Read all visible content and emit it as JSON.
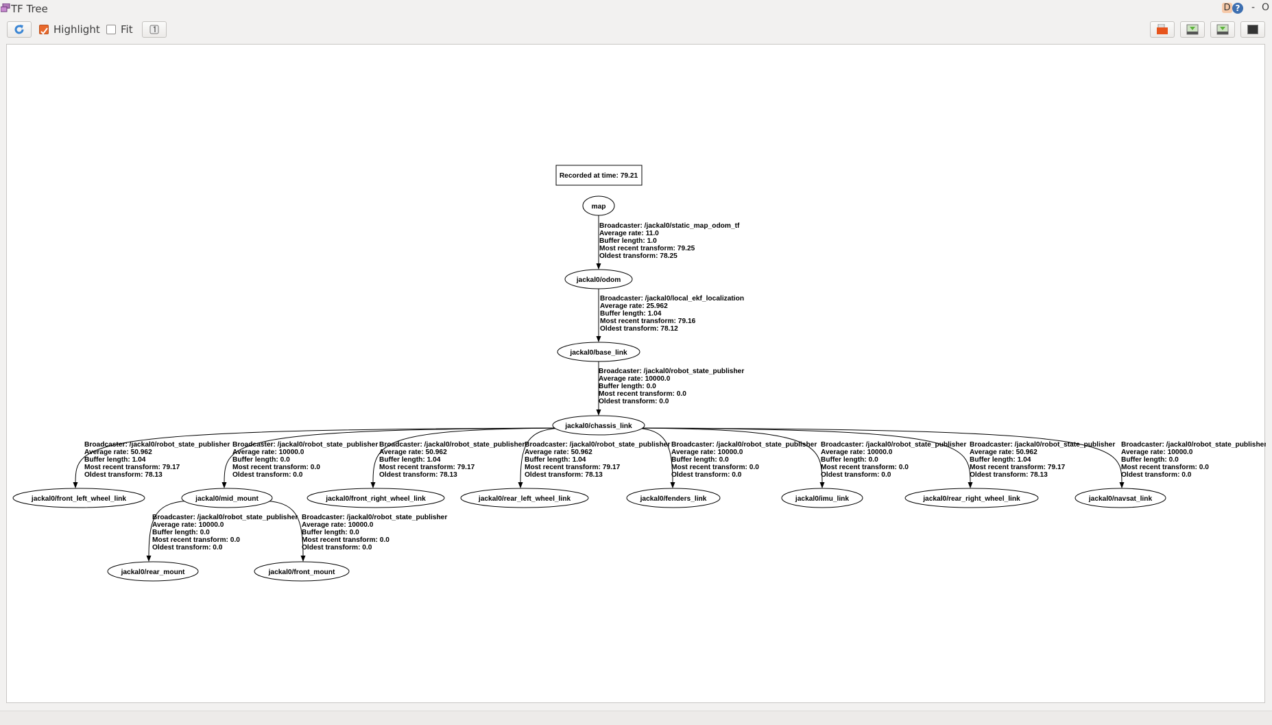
{
  "window": {
    "title": "TF Tree",
    "top_right": {
      "d_label": "D",
      "help_label": "?",
      "minimize_label": "-",
      "restore_label": "O"
    }
  },
  "toolbar": {
    "refresh_icon": "refresh-icon",
    "highlight": {
      "label": "Highlight",
      "checked": true
    },
    "fit": {
      "label": "Fit",
      "checked": false
    },
    "fit_button_icon": "one-to-one-icon",
    "right_buttons": [
      "open-file-icon",
      "save-dot-icon",
      "save-image-icon",
      "screen-icon"
    ],
    "accent": "#e8692c"
  },
  "graph": {
    "recorded": "Recorded at time: 79.21",
    "nodes": [
      {
        "id": "map",
        "label": "map"
      },
      {
        "id": "odom",
        "label": "jackal0/odom"
      },
      {
        "id": "base",
        "label": "jackal0/base_link"
      },
      {
        "id": "chassis",
        "label": "jackal0/chassis_link"
      },
      {
        "id": "fl",
        "label": "jackal0/front_left_wheel_link"
      },
      {
        "id": "mid",
        "label": "jackal0/mid_mount"
      },
      {
        "id": "fr",
        "label": "jackal0/front_right_wheel_link"
      },
      {
        "id": "rl",
        "label": "jackal0/rear_left_wheel_link"
      },
      {
        "id": "fenders",
        "label": "jackal0/fenders_link"
      },
      {
        "id": "imu",
        "label": "jackal0/imu_link"
      },
      {
        "id": "rr",
        "label": "jackal0/rear_right_wheel_link"
      },
      {
        "id": "navsat",
        "label": "jackal0/navsat_link"
      },
      {
        "id": "rear_mount",
        "label": "jackal0/rear_mount"
      },
      {
        "id": "front_mount",
        "label": "jackal0/front_mount"
      }
    ],
    "edges": [
      {
        "from": "map",
        "to": "odom",
        "label": [
          "Broadcaster: /jackal0/static_map_odom_tf",
          "Average rate: 11.0",
          "Buffer length: 1.0",
          "Most recent transform: 79.25",
          "Oldest transform: 78.25"
        ]
      },
      {
        "from": "odom",
        "to": "base",
        "label": [
          "Broadcaster: /jackal0/local_ekf_localization",
          "Average rate: 25.962",
          "Buffer length: 1.04",
          "Most recent transform: 79.16",
          "Oldest transform: 78.12"
        ]
      },
      {
        "from": "base",
        "to": "chassis",
        "label": [
          "Broadcaster: /jackal0/robot_state_publisher",
          "Average rate: 10000.0",
          "Buffer length: 0.0",
          "Most recent transform: 0.0",
          "Oldest transform: 0.0"
        ]
      },
      {
        "from": "chassis",
        "to": "fl",
        "label": [
          "Broadcaster: /jackal0/robot_state_publisher",
          "Average rate: 50.962",
          "Buffer length: 1.04",
          "Most recent transform: 79.17",
          "Oldest transform: 78.13"
        ]
      },
      {
        "from": "chassis",
        "to": "mid",
        "label": [
          "Broadcaster: /jackal0/robot_state_publisher",
          "Average rate: 10000.0",
          "Buffer length: 0.0",
          "Most recent transform: 0.0",
          "Oldest transform: 0.0"
        ]
      },
      {
        "from": "chassis",
        "to": "fr",
        "label": [
          "Broadcaster: /jackal0/robot_state_publisher",
          "Average rate: 50.962",
          "Buffer length: 1.04",
          "Most recent transform: 79.17",
          "Oldest transform: 78.13"
        ]
      },
      {
        "from": "chassis",
        "to": "rl",
        "label": [
          "Broadcaster: /jackal0/robot_state_publisher",
          "Average rate: 50.962",
          "Buffer length: 1.04",
          "Most recent transform: 79.17",
          "Oldest transform: 78.13"
        ]
      },
      {
        "from": "chassis",
        "to": "fenders",
        "label": [
          "Broadcaster: /jackal0/robot_state_publisher",
          "Average rate: 10000.0",
          "Buffer length: 0.0",
          "Most recent transform: 0.0",
          "Oldest transform: 0.0"
        ]
      },
      {
        "from": "chassis",
        "to": "imu",
        "label": [
          "Broadcaster: /jackal0/robot_state_publisher",
          "Average rate: 10000.0",
          "Buffer length: 0.0",
          "Most recent transform: 0.0",
          "Oldest transform: 0.0"
        ]
      },
      {
        "from": "chassis",
        "to": "rr",
        "label": [
          "Broadcaster: /jackal0/robot_state_publisher",
          "Average rate: 50.962",
          "Buffer length: 1.04",
          "Most recent transform: 79.17",
          "Oldest transform: 78.13"
        ]
      },
      {
        "from": "chassis",
        "to": "navsat",
        "label": [
          "Broadcaster: /jackal0/robot_state_publisher",
          "Average rate: 10000.0",
          "Buffer length: 0.0",
          "Most recent transform: 0.0",
          "Oldest transform: 0.0"
        ]
      },
      {
        "from": "mid",
        "to": "rear_mount",
        "label": [
          "Broadcaster: /jackal0/robot_state_publisher",
          "Average rate: 10000.0",
          "Buffer length: 0.0",
          "Most recent transform: 0.0",
          "Oldest transform: 0.0"
        ]
      },
      {
        "from": "mid",
        "to": "front_mount",
        "label": [
          "Broadcaster: /jackal0/robot_state_publisher",
          "Average rate: 10000.0",
          "Buffer length: 0.0",
          "Most recent transform: 0.0",
          "Oldest transform: 0.0"
        ]
      }
    ]
  }
}
